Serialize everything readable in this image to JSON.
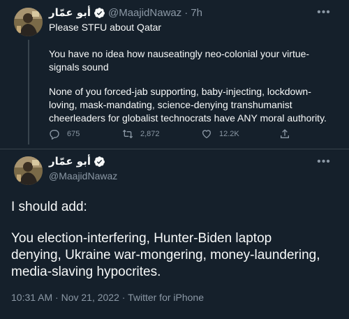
{
  "parent_tweet": {
    "display_name": "أبو عمّار",
    "handle": "@MaajidNawaz",
    "separator": "·",
    "time": "7h",
    "more_label": "•••",
    "text_line1": "Please STFU about Qatar",
    "text_para2": "You have no idea how nauseatingly neo-colonial your virtue-signals sound",
    "text_para3": "None of you forced-jab supporting, baby-injecting, lockdown-loving, mask-mandating, science-denying transhumanist cheerleaders for globalist technocrats have ANY moral authority.",
    "replies": "675",
    "retweets": "2,872",
    "likes": "12.2K"
  },
  "main_tweet": {
    "display_name": "أبو عمّار",
    "handle": "@MaajidNawaz",
    "more_label": "•••",
    "text_para1": "I should add:",
    "text_para2": "You election-interfering, Hunter-Biden laptop denying, Ukraine war-mongering, money-laundering, media-slaving hypocrites.",
    "meta": "10:31 AM · Nov 21, 2022 · Twitter for iPhone"
  },
  "colors": {
    "background": "#15202b",
    "text": "#f7f9f9",
    "secondary": "#8b98a5",
    "divider": "#38444d"
  }
}
